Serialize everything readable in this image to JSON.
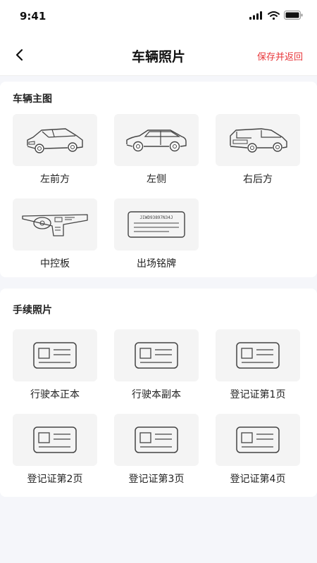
{
  "status_bar": {
    "time": "9:41"
  },
  "nav": {
    "title": "车辆照片",
    "save_label": "保存并返回"
  },
  "vehicle_section": {
    "title": "车辆主图",
    "items": [
      {
        "label": "左前方",
        "icon": "car-front-left-icon"
      },
      {
        "label": "左侧",
        "icon": "car-side-icon"
      },
      {
        "label": "右后方",
        "icon": "car-rear-right-icon"
      },
      {
        "label": "中控板",
        "icon": "dashboard-icon"
      },
      {
        "label": "出场铭牌",
        "icon": "nameplate-icon",
        "plate_text": "JIWD93897N34J"
      }
    ]
  },
  "documents_section": {
    "title": "手续照片",
    "items": [
      {
        "label": "行驶本正本",
        "icon": "id-card-icon"
      },
      {
        "label": "行驶本副本",
        "icon": "id-card-icon"
      },
      {
        "label": "登记证第1页",
        "icon": "id-card-icon"
      },
      {
        "label": "登记证第2页",
        "icon": "id-card-icon"
      },
      {
        "label": "登记证第3页",
        "icon": "id-card-icon"
      },
      {
        "label": "登记证第4页",
        "icon": "id-card-icon"
      }
    ]
  },
  "colors": {
    "accent": "#e8373a",
    "background": "#f5f6fa",
    "tile": "#f4f4f4",
    "line": "#444444"
  }
}
